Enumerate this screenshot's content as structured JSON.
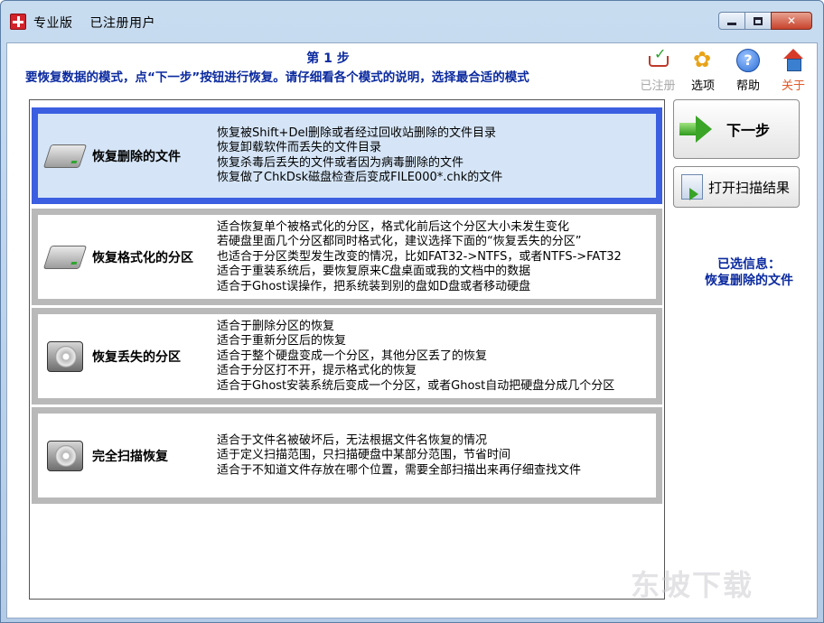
{
  "window": {
    "title": "专业版",
    "subtitle": "已注册用户"
  },
  "header": {
    "step": "第 1 步",
    "description": "要恢复数据的模式，点“下一步”按钮进行恢复。请仔细看各个模式的说明，选择最合适的模式"
  },
  "toolbar": {
    "registered": "已注册",
    "options": "选项",
    "help": "帮助",
    "about": "关于"
  },
  "modes": [
    {
      "name": "恢复删除的文件",
      "lines": [
        "恢复被Shift+Del删除或者经过回收站删除的文件目录",
        "恢复卸载软件而丢失的文件目录",
        "恢复杀毒后丢失的文件或者因为病毒删除的文件",
        "恢复做了ChkDsk磁盘检查后变成FILE000*.chk的文件"
      ]
    },
    {
      "name": "恢复格式化的分区",
      "lines": [
        "适合恢复单个被格式化的分区，格式化前后这个分区大小未发生变化",
        "若硬盘里面几个分区都同时格式化，建议选择下面的“恢复丢失的分区”",
        "也适合于分区类型发生改变的情况，比如FAT32->NTFS，或者NTFS->FAT32",
        "适合于重装系统后，要恢复原来C盘桌面或我的文档中的数据",
        "适合于Ghost误操作，把系统装到别的盘如D盘或者移动硬盘"
      ]
    },
    {
      "name": "恢复丢失的分区",
      "lines": [
        "适合于删除分区的恢复",
        "适合于重新分区后的恢复",
        "适合于整个硬盘变成一个分区，其他分区丢了的恢复",
        "适合于分区打不开，提示格式化的恢复",
        "适合于Ghost安装系统后变成一个分区，或者Ghost自动把硬盘分成几个分区"
      ]
    },
    {
      "name": "完全扫描恢复",
      "lines": [
        "适合于文件名被破坏后，无法根据文件名恢复的情况",
        "适于定义扫描范围，只扫描硬盘中某部分范围，节省时间",
        "适合于不知道文件存放在哪个位置，需要全部扫描出来再仔细查找文件"
      ]
    }
  ],
  "buttons": {
    "next": "下一步",
    "open_scan": "打开扫描结果"
  },
  "selection": {
    "label": "已选信息：",
    "value": "恢复删除的文件"
  },
  "watermark": "东坡下载"
}
